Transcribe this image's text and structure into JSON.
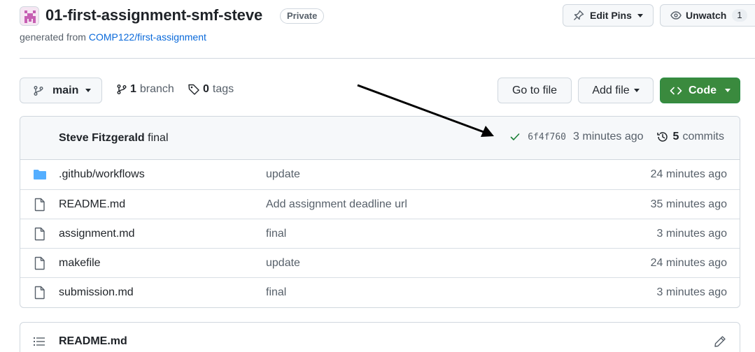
{
  "header": {
    "repo_name": "01-first-assignment-smf-steve",
    "visibility": "Private",
    "generated_prefix": "generated from ",
    "generated_link": "COMP122/first-assignment",
    "edit_pins_label": "Edit Pins",
    "unwatch_label": "Unwatch",
    "watch_count": "1"
  },
  "toolbar": {
    "branch_name": "main",
    "branch_count": "1",
    "branch_label": "branch",
    "tag_count": "0",
    "tag_label": "tags",
    "goto_label": "Go to file",
    "addfile_label": "Add file",
    "code_label": "Code"
  },
  "latest_commit": {
    "author": "Steve Fitzgerald",
    "message": "final",
    "sha": "6f4f760",
    "time": "3 minutes ago",
    "commit_count": "5",
    "commits_label": "commits"
  },
  "files": [
    {
      "name": ".github/workflows",
      "type": "folder",
      "message": "update",
      "time": "24 minutes ago"
    },
    {
      "name": "README.md",
      "type": "file",
      "message": "Add assignment deadline url",
      "time": "35 minutes ago"
    },
    {
      "name": "assignment.md",
      "type": "file",
      "message": "final",
      "time": "3 minutes ago"
    },
    {
      "name": "makefile",
      "type": "file",
      "message": "update",
      "time": "24 minutes ago"
    },
    {
      "name": "submission.md",
      "type": "file",
      "message": "final",
      "time": "3 minutes ago"
    }
  ],
  "readme": {
    "title": "README.md"
  },
  "colors": {
    "accent_blue": "#0969da",
    "code_green": "#3a8a3e",
    "folder_blue": "#54aeff",
    "check_green": "#1a7f37"
  }
}
